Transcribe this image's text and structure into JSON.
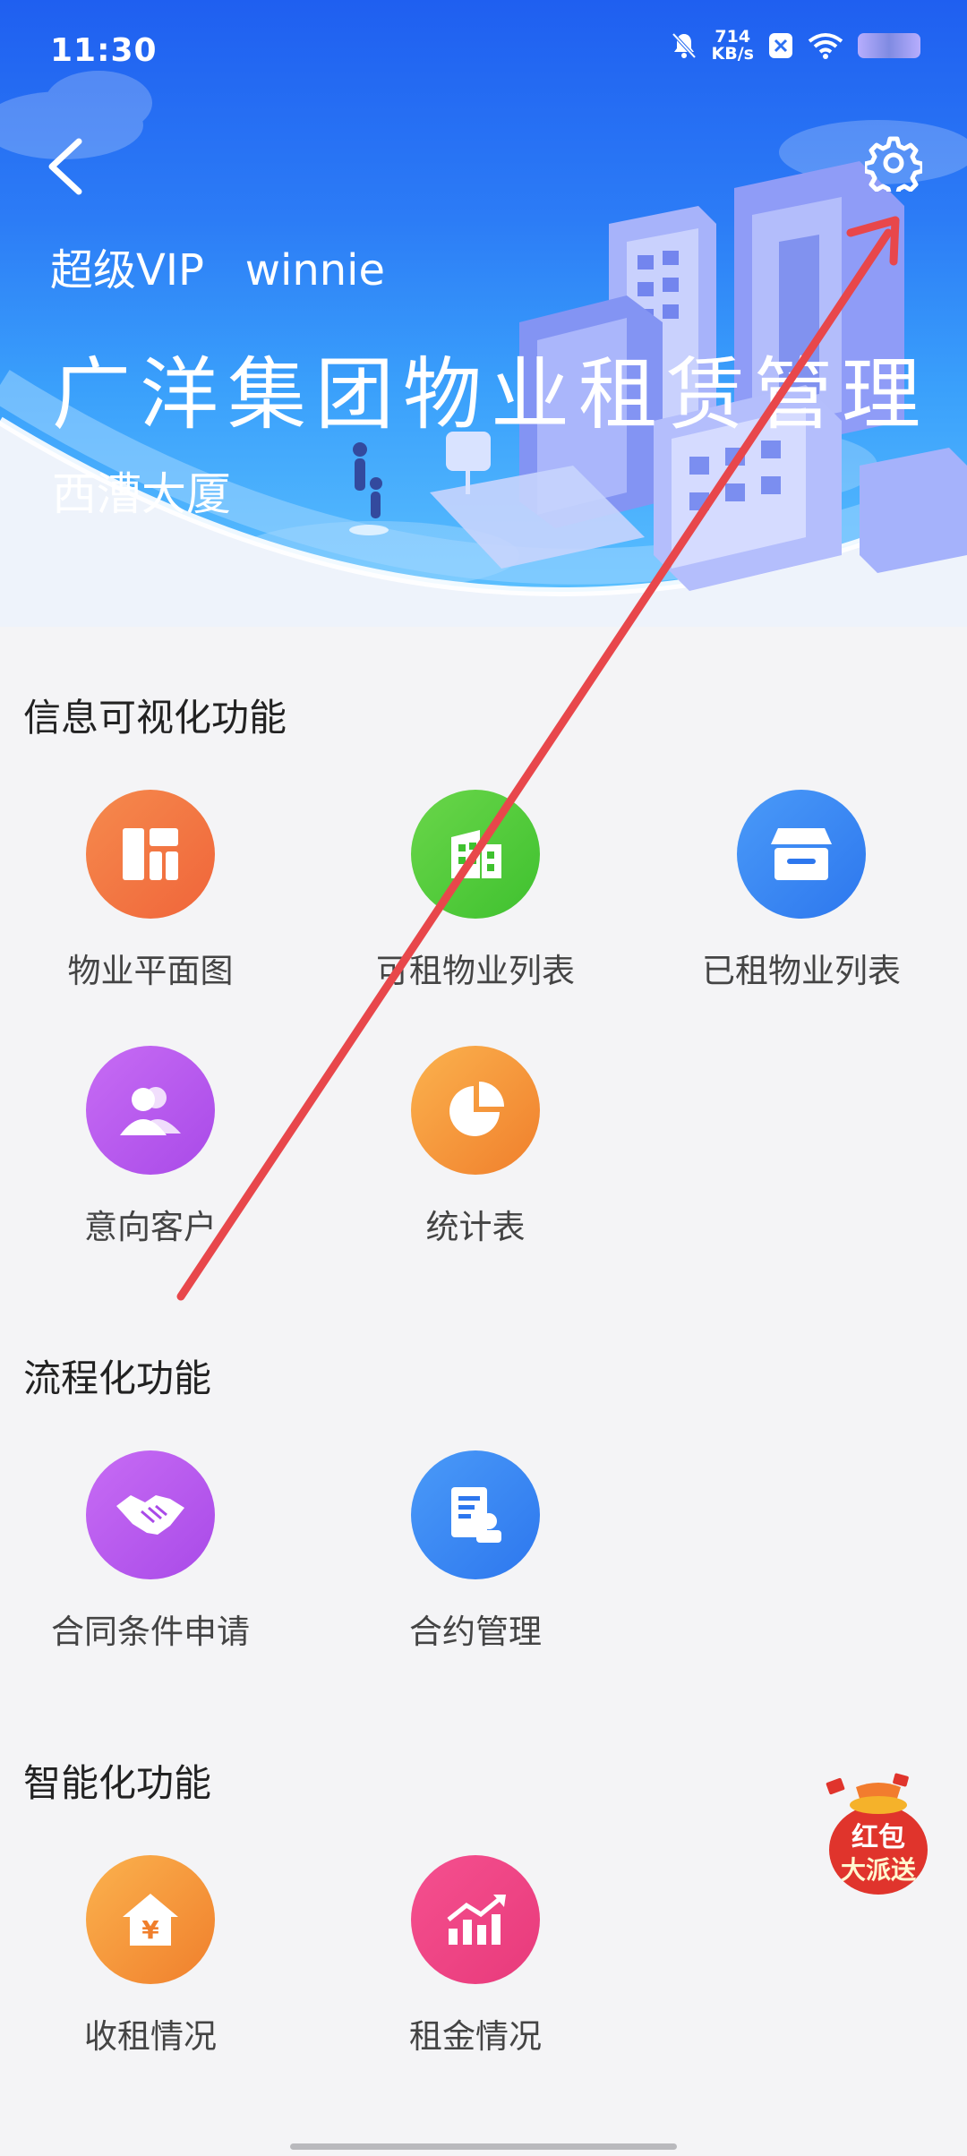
{
  "status_bar": {
    "time": "11:30",
    "net_speed_value": "714",
    "net_speed_unit": "KB/s",
    "icons": [
      "bell-muted-icon",
      "x-app-icon",
      "wifi-icon",
      "battery-icon"
    ]
  },
  "header": {
    "back_icon": "chevron-left-icon",
    "settings_icon": "gear-icon",
    "vip_label": "超级VIP",
    "username": "winnie",
    "app_title": "广洋集团物业租赁管理",
    "building_name": "西漕大厦",
    "colors": {
      "gradient_top": "#1f5ff0",
      "gradient_bottom": "#5fc4ff"
    }
  },
  "sections": [
    {
      "title": "信息可视化功能",
      "items": [
        {
          "label": "物业平面图",
          "icon": "floorplan-icon",
          "color": "#f0653a"
        },
        {
          "label": "可租物业列表",
          "icon": "building-icon",
          "color": "#3fc12f"
        },
        {
          "label": "已租物业列表",
          "icon": "storefront-icon",
          "color": "#2d77ee"
        },
        {
          "label": "意向客户",
          "icon": "users-icon",
          "color": "#a94ae8"
        },
        {
          "label": "统计表",
          "icon": "pie-chart-icon",
          "color": "#f07f2c"
        }
      ]
    },
    {
      "title": "流程化功能",
      "items": [
        {
          "label": "合同条件申请",
          "icon": "handshake-icon",
          "color": "#a94ae8"
        },
        {
          "label": "合约管理",
          "icon": "contract-icon",
          "color": "#2d77ee"
        }
      ]
    },
    {
      "title": "智能化功能",
      "items": [
        {
          "label": "收租情况",
          "icon": "rent-house-icon",
          "color": "#f07f2c"
        },
        {
          "label": "租金情况",
          "icon": "trend-chart-icon",
          "color": "#e83a7b"
        }
      ]
    }
  ],
  "floating": {
    "red_packet_line1": "红包",
    "red_packet_line2": "大派送",
    "color": "#e0342c"
  },
  "annotation_color": "#e8474b"
}
